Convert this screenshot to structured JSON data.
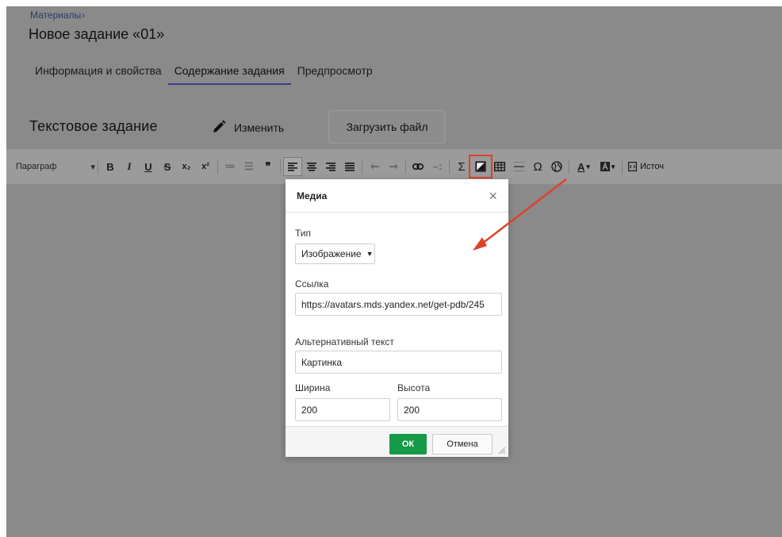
{
  "breadcrumb": {
    "label": "Материалы",
    "sep": "›"
  },
  "page_title": "Новое задание «01»",
  "tabs": [
    {
      "label": "Информация и свойства",
      "active": false
    },
    {
      "label": "Содержание задания",
      "active": true
    },
    {
      "label": "Предпросмотр",
      "active": false
    }
  ],
  "section": {
    "title": "Текстовое задание",
    "edit_label": "Изменить",
    "upload_label": "Загрузить файл"
  },
  "toolbar": {
    "paragraph": "Параграф",
    "caret": "▾",
    "bold": "B",
    "italic": "I",
    "underline": "U",
    "strike": "S",
    "subscript": "x₂",
    "superscript": "x²",
    "ordered_list": "≔",
    "bullet_list": "☰",
    "quote": "❞",
    "sigma": "Σ",
    "omega": "Ω",
    "text_color": "A",
    "source": "Источ"
  },
  "dialog": {
    "title": "Медиа",
    "close": "×",
    "type_label": "Тип",
    "type_value": "Изображение",
    "type_caret": "▼",
    "link_label": "Ссылка",
    "link_value": "https://avatars.mds.yandex.net/get-pdb/245",
    "alt_label": "Альтернативный текст",
    "alt_value": "Картинка",
    "width_label": "Ширина",
    "width_value": "200",
    "height_label": "Высота",
    "height_value": "200",
    "ok": "ОК",
    "cancel": "Отмена"
  },
  "colors": {
    "ok_green": "#159a47",
    "annotation_red": "#e0412a",
    "tab_underline": "#3b3f8c"
  }
}
